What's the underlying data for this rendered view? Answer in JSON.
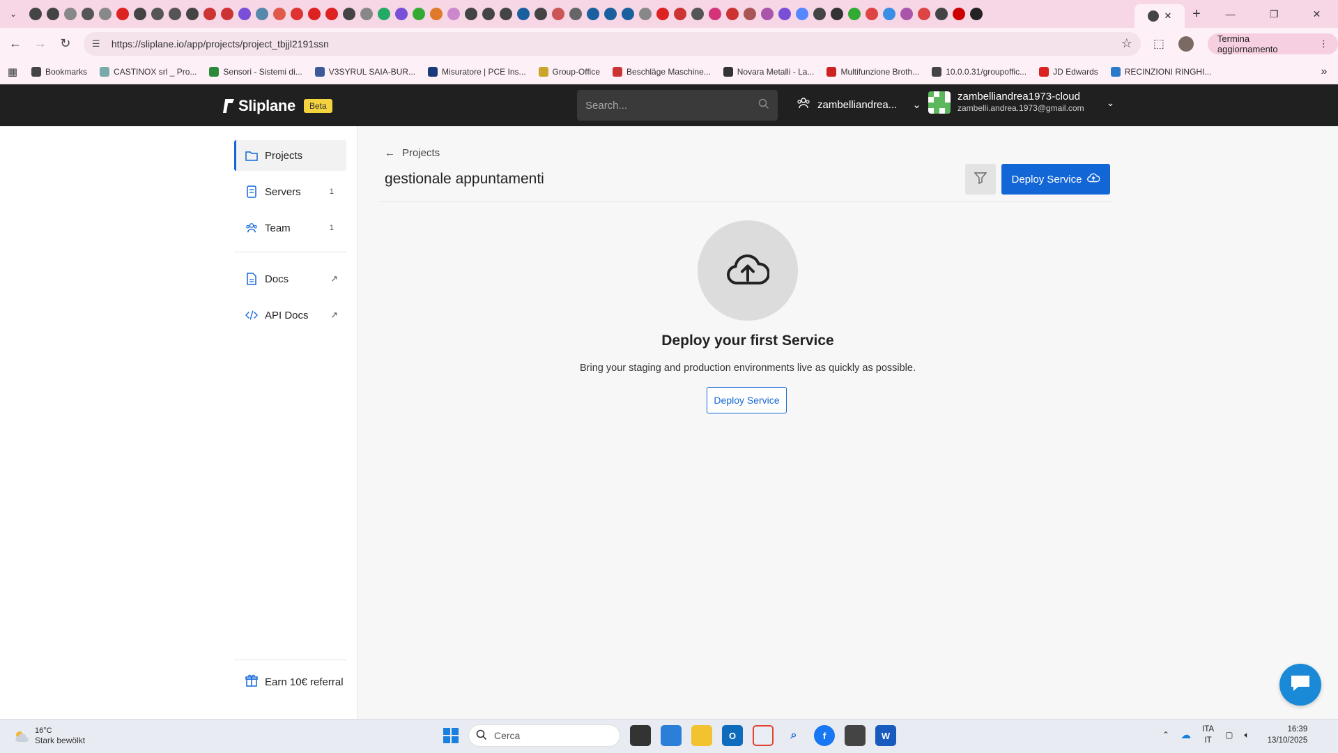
{
  "browser": {
    "url": "https://sliplane.io/app/projects/project_tbjjl2191ssn",
    "update_label": "Termina aggiornamento",
    "tab_favicon_colors": [
      "#444",
      "#444",
      "#888",
      "#555",
      "#888",
      "#d22",
      "#444",
      "#555",
      "#555",
      "#444",
      "#c33",
      "#c33",
      "#7a4fd8",
      "#58a",
      "#e05a4a",
      "#d33",
      "#d22",
      "#d22",
      "#444",
      "#888",
      "#2a6",
      "#7a4fd8",
      "#3a3",
      "#e07a2a",
      "#c8c",
      "#444",
      "#444",
      "#444",
      "#1a5f9e",
      "#444",
      "#c55",
      "#666",
      "#1a5f9e",
      "#1a5f9e",
      "#1a5f9e",
      "#888",
      "#d22",
      "#c33",
      "#555",
      "#d4337a",
      "#c33",
      "#a55",
      "#a5a",
      "#7a4fd8",
      "#58f",
      "#444",
      "#333",
      "#3a3",
      "#d44",
      "#3a8ee6",
      "#a5a",
      "#d44",
      "#444",
      "#c00",
      "#222"
    ],
    "bookmarks": [
      {
        "label": "Bookmarks",
        "color": "#444"
      },
      {
        "label": "CASTINOX srl _ Pro...",
        "color": "#7aa"
      },
      {
        "label": "Sensori - Sistemi di...",
        "color": "#2a8a3a"
      },
      {
        "label": "V3SYRUL SAIA-BUR...",
        "color": "#3a5a9a"
      },
      {
        "label": "Misuratore | PCE Ins...",
        "color": "#1a3a7a"
      },
      {
        "label": "Group-Office",
        "color": "#c9a52a"
      },
      {
        "label": "Beschläge Maschine...",
        "color": "#c33"
      },
      {
        "label": "Novara Metalli - La...",
        "color": "#333"
      },
      {
        "label": "Multifunzione Broth...",
        "color": "#c22"
      },
      {
        "label": "10.0.0.31/groupoffic...",
        "color": "#444"
      },
      {
        "label": "JD Edwards",
        "color": "#d22"
      },
      {
        "label": "RECINZIONI RINGHI...",
        "color": "#2a7ac9"
      }
    ]
  },
  "header": {
    "brand": "Sliplane",
    "beta_label": "Beta",
    "search_placeholder": "Search...",
    "org_name": "zambelliandrea...",
    "user_name": "zambelliandrea1973-cloud",
    "user_email": "zambelli.andrea.1973@gmail.com"
  },
  "sidebar": {
    "items": [
      {
        "label": "Projects",
        "icon": "folder-icon"
      },
      {
        "label": "Servers",
        "count": "1",
        "icon": "server-icon"
      },
      {
        "label": "Team",
        "count": "1",
        "icon": "team-icon"
      }
    ],
    "links": [
      {
        "label": "Docs",
        "icon": "document-icon"
      },
      {
        "label": "API Docs",
        "icon": "code-icon"
      }
    ],
    "referral": "Earn 10€ referral"
  },
  "main": {
    "back_label": "Projects",
    "title": "gestionale appuntamenti",
    "deploy_label": "Deploy Service",
    "empty_title": "Deploy your first Service",
    "empty_desc": "Bring your staging and production environments live as quickly as possible.",
    "empty_button": "Deploy Service"
  },
  "taskbar": {
    "temperature": "16°C",
    "weather": "Stark bewölkt",
    "search_label": "Cerca",
    "lang_1": "ITA",
    "lang_2": "IT",
    "time": "16:39",
    "date": "13/10/2025"
  },
  "colors": {
    "accent": "#1366d6",
    "header_bg": "#202020",
    "beta_badge": "#f5d340",
    "tabbar": "#f7d6e6"
  }
}
